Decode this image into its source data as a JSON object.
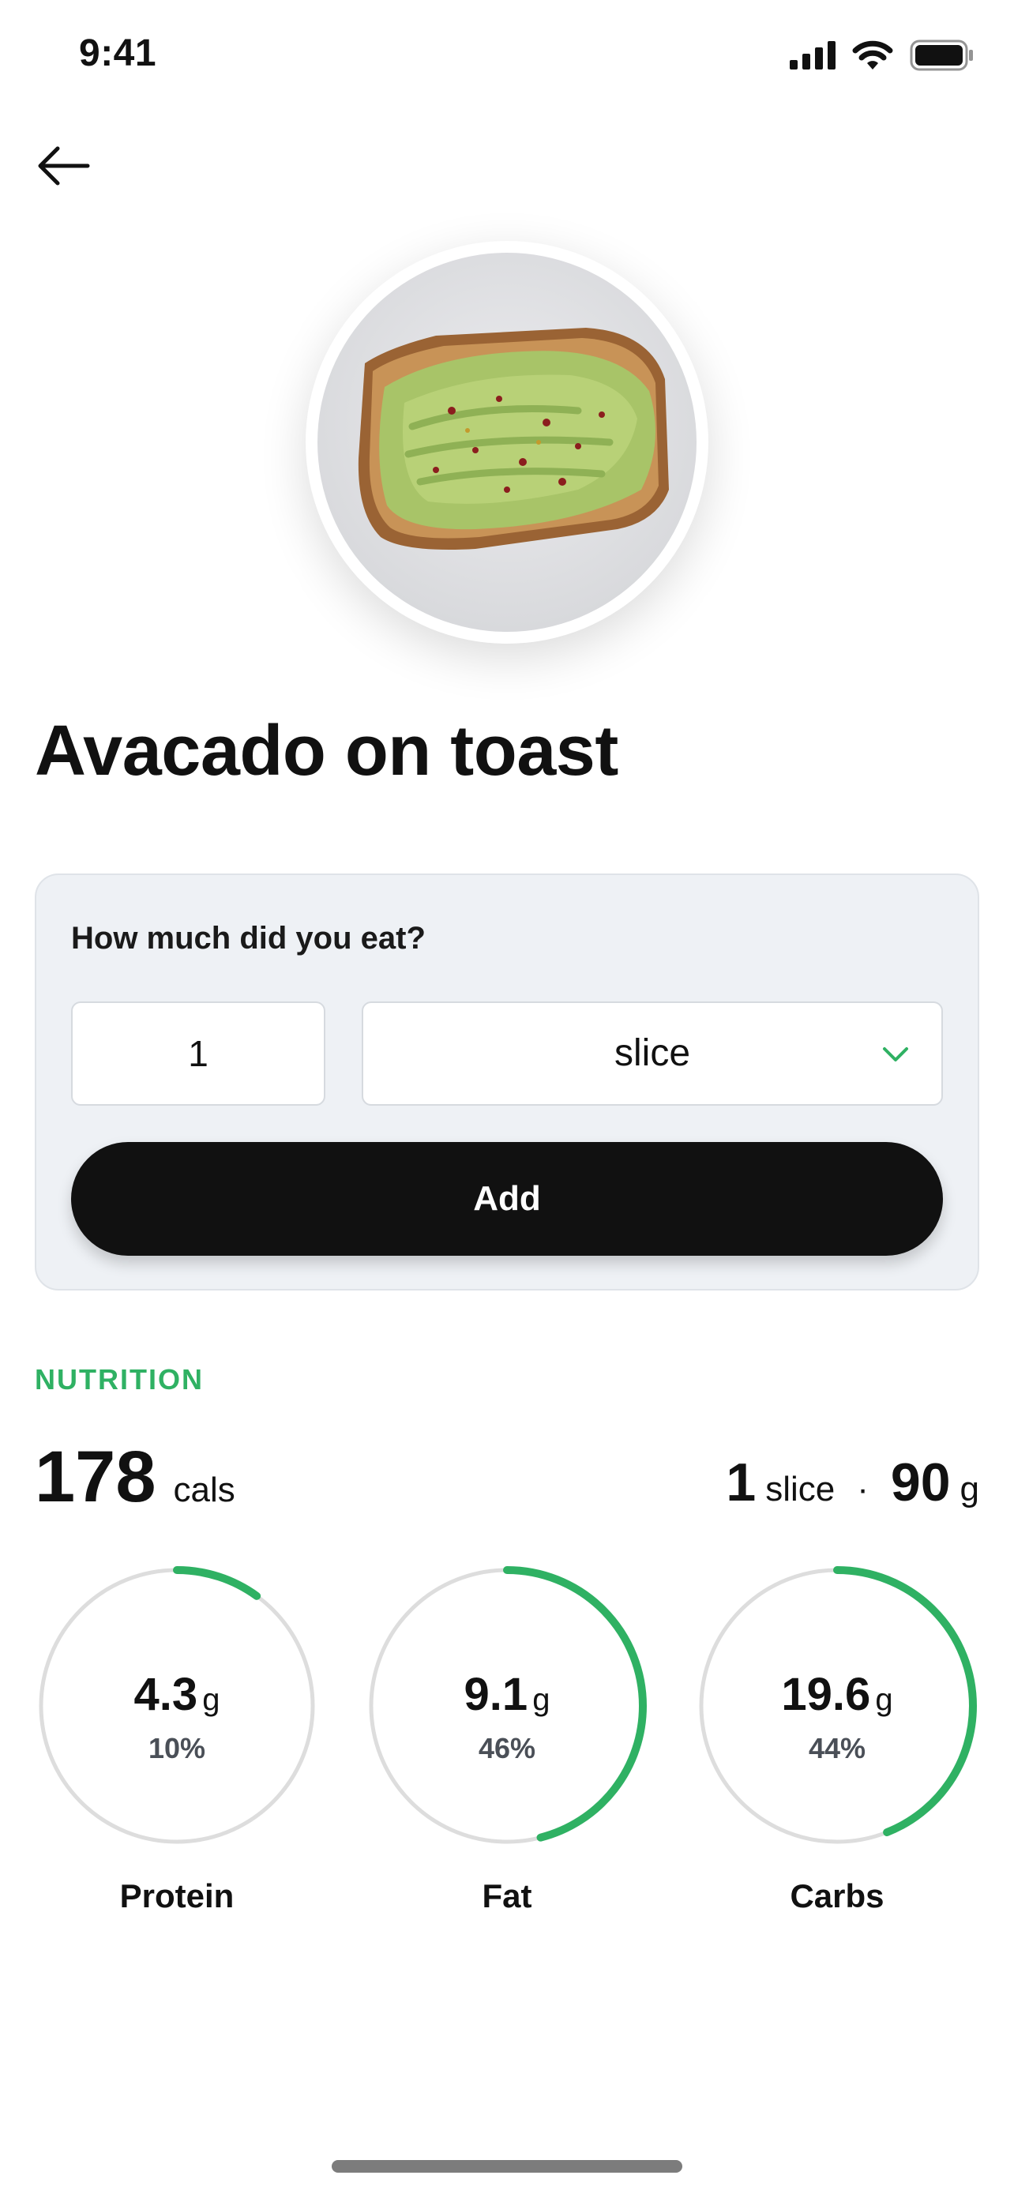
{
  "status_bar": {
    "time": "9:41"
  },
  "food": {
    "name": "Avacado on toast",
    "image_icon": "avocado-toast-image"
  },
  "serving": {
    "question": "How much did you eat?",
    "quantity": "1",
    "unit": "slice",
    "add_label": "Add"
  },
  "nutrition": {
    "heading": "NUTRITION",
    "calories": "178",
    "calories_unit": "cals",
    "portion_count": "1",
    "portion_unit": "slice",
    "separator": "·",
    "portion_weight": "90",
    "weight_unit": "g",
    "macros": [
      {
        "name": "Protein",
        "amount": "4.3",
        "unit": "g",
        "percent_label": "10%",
        "percent": 10
      },
      {
        "name": "Fat",
        "amount": "9.1",
        "unit": "g",
        "percent_label": "46%",
        "percent": 46
      },
      {
        "name": "Carbs",
        "amount": "19.6",
        "unit": "g",
        "percent_label": "44%",
        "percent": 44
      }
    ]
  },
  "colors": {
    "accent": "#2fb163",
    "button": "#111111",
    "card_bg": "#eef1f5",
    "ring_track": "#dddddd"
  }
}
